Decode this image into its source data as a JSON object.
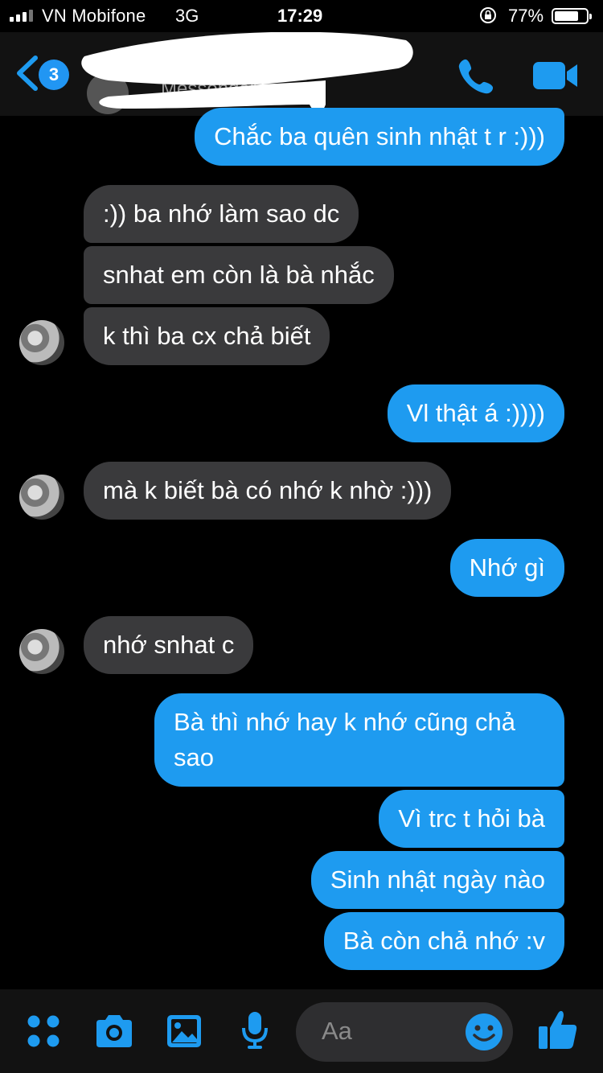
{
  "status_bar": {
    "carrier": "VN Mobifone",
    "network": "3G",
    "time": "17:29",
    "battery_percent": "77%",
    "battery_level": 0.77
  },
  "header": {
    "unread_count": "3",
    "contact_subtitle": "Messenger"
  },
  "messages": [
    {
      "side": "out",
      "text": "Chắc ba quên sinh nhật t r :)))"
    },
    {
      "side": "in",
      "text": ":)) ba nhớ làm sao dc"
    },
    {
      "side": "in",
      "text": "snhat em còn là bà nhắc"
    },
    {
      "side": "in",
      "text": "k thì ba cx chả biết"
    },
    {
      "side": "out",
      "text": "Vl thật á :))))"
    },
    {
      "side": "in",
      "text": "mà k biết bà có nhớ k nhờ :)))"
    },
    {
      "side": "out",
      "text": "Nhớ gì"
    },
    {
      "side": "in",
      "text": "nhớ snhat c"
    },
    {
      "side": "out",
      "text": "Bà thì nhớ hay k nhớ cũng chả sao"
    },
    {
      "side": "out",
      "text": "Vì trc t hỏi bà"
    },
    {
      "side": "out",
      "text": "Sinh nhật ngày nào"
    },
    {
      "side": "out",
      "text": "Bà còn chả nhớ :v"
    }
  ],
  "composer": {
    "placeholder": "Aa"
  },
  "colors": {
    "accent": "#1e9bf0",
    "incoming_bubble": "#3a3a3c",
    "background": "#000000"
  }
}
